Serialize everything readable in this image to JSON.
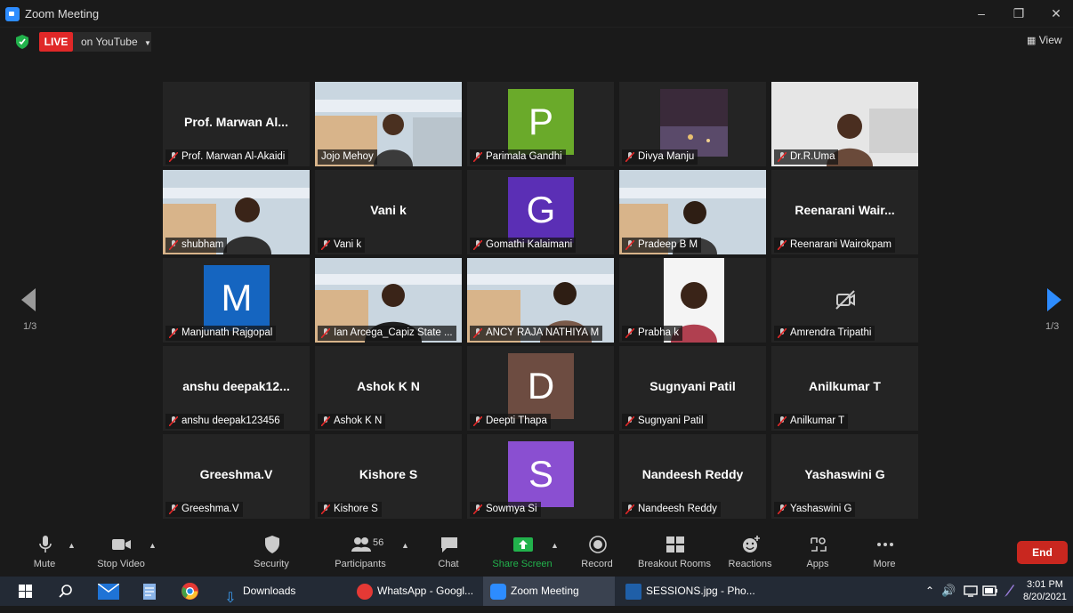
{
  "window": {
    "title": "Zoom Meeting"
  },
  "topbar": {
    "live_label": "LIVE",
    "stream_label": "on YouTube",
    "view_label": "View"
  },
  "pager": {
    "left": "1/3",
    "right": "1/3"
  },
  "tiles": [
    {
      "big": "Prof. Marwan Al...",
      "tag": "Prof. Marwan Al-Akaidi"
    },
    {
      "tag": "Jojo Mehoy"
    },
    {
      "avatar": "P",
      "avatar_color": "#6aaa2a",
      "tag": "Parimala Gandhi"
    },
    {
      "tag": "Divya Manju"
    },
    {
      "tag": "Dr.R.Uma"
    },
    {
      "tag": "shubham"
    },
    {
      "big": "Vani k",
      "tag": "Vani k"
    },
    {
      "avatar": "G",
      "avatar_color": "#5b2fb5",
      "tag": "Gomathi Kalaimani"
    },
    {
      "tag": "Pradeep B M"
    },
    {
      "big": "Reenarani  Wair...",
      "tag": "Reenarani Wairokpam"
    },
    {
      "avatar": "M",
      "avatar_color": "#1565c0",
      "tag": "Manjunath Rajgopal"
    },
    {
      "tag": "Ian Arcega_Capiz State ..."
    },
    {
      "tag": "ANCY RAJA NATHIYA M"
    },
    {
      "tag": "Prabha k"
    },
    {
      "tag": "Amrendra Tripathi"
    },
    {
      "big": "anshu  deepak12...",
      "tag": "anshu deepak123456"
    },
    {
      "big": "Ashok K N",
      "tag": "Ashok K N"
    },
    {
      "avatar": "D",
      "avatar_color": "#6d4c41",
      "tag": "Deepti Thapa"
    },
    {
      "big": "Sugnyani Patil",
      "tag": "Sugnyani Patil"
    },
    {
      "big": "Anilkumar T",
      "tag": "Anilkumar T"
    },
    {
      "big": "Greeshma.V",
      "tag": "Greeshma.V"
    },
    {
      "big": "Kishore S",
      "tag": "Kishore S"
    },
    {
      "avatar": "S",
      "avatar_color": "#8a4fd1",
      "tag": "Sowmya Si"
    },
    {
      "big": "Nandeesh Reddy",
      "tag": "Nandeesh Reddy"
    },
    {
      "big": "Yashaswini G",
      "tag": "Yashaswini G"
    }
  ],
  "toolbar": {
    "mute": "Mute",
    "stop_video": "Stop Video",
    "security": "Security",
    "participants": "Participants",
    "participants_count": "56",
    "chat": "Chat",
    "share_screen": "Share Screen",
    "record": "Record",
    "breakout_rooms": "Breakout Rooms",
    "reactions": "Reactions",
    "apps": "Apps",
    "more": "More",
    "end": "End"
  },
  "taskbar": {
    "downloads": "Downloads",
    "whatsapp": "WhatsApp - Googl...",
    "zoom": "Zoom Meeting",
    "photos": "SESSIONS.jpg - Pho...",
    "time": "3:01 PM",
    "date": "8/20/2021"
  },
  "colors": {
    "live": "#e02828",
    "share_screen": "#22b24c",
    "end": "#c9271f",
    "active_speaker": "#7ddc2a"
  }
}
